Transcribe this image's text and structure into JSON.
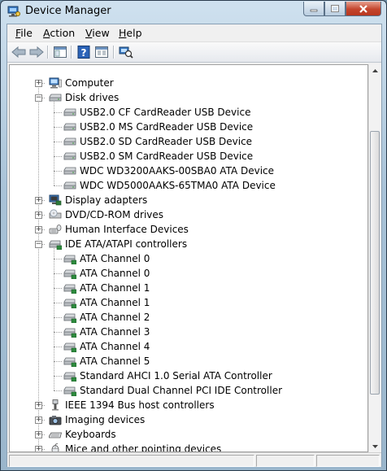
{
  "window": {
    "title": "Device Manager"
  },
  "menus": [
    {
      "key": "F",
      "rest": "ile"
    },
    {
      "key": "A",
      "rest": "ction"
    },
    {
      "key": "V",
      "rest": "iew"
    },
    {
      "key": "H",
      "rest": "elp"
    }
  ],
  "tree": [
    {
      "label": "Computer",
      "icon": "computer-icon",
      "level": 0,
      "state": "collapsed"
    },
    {
      "label": "Disk drives",
      "icon": "disk-drive-icon",
      "level": 0,
      "state": "expanded"
    },
    {
      "label": "USB2.0 CF  CardReader USB Device",
      "icon": "disk-drive-icon",
      "level": 1
    },
    {
      "label": "USB2.0 MS  CardReader USB Device",
      "icon": "disk-drive-icon",
      "level": 1
    },
    {
      "label": "USB2.0 SD  CardReader USB Device",
      "icon": "disk-drive-icon",
      "level": 1
    },
    {
      "label": "USB2.0 SM  CardReader USB Device",
      "icon": "disk-drive-icon",
      "level": 1
    },
    {
      "label": "WDC WD3200AAKS-00SBA0 ATA Device",
      "icon": "disk-drive-icon",
      "level": 1
    },
    {
      "label": "WDC WD5000AAKS-65TMA0 ATA Device",
      "icon": "disk-drive-icon",
      "level": 1
    },
    {
      "label": "Display adapters",
      "icon": "display-adapter-icon",
      "level": 0,
      "state": "collapsed"
    },
    {
      "label": "DVD/CD-ROM drives",
      "icon": "dvd-drive-icon",
      "level": 0,
      "state": "collapsed"
    },
    {
      "label": "Human Interface Devices",
      "icon": "hid-icon",
      "level": 0,
      "state": "collapsed"
    },
    {
      "label": "IDE ATA/ATAPI controllers",
      "icon": "ide-controller-icon",
      "level": 0,
      "state": "expanded"
    },
    {
      "label": "ATA Channel 0",
      "icon": "ide-controller-icon",
      "level": 1
    },
    {
      "label": "ATA Channel 0",
      "icon": "ide-controller-icon",
      "level": 1
    },
    {
      "label": "ATA Channel 1",
      "icon": "ide-controller-icon",
      "level": 1
    },
    {
      "label": "ATA Channel 1",
      "icon": "ide-controller-icon",
      "level": 1
    },
    {
      "label": "ATA Channel 2",
      "icon": "ide-controller-icon",
      "level": 1
    },
    {
      "label": "ATA Channel 3",
      "icon": "ide-controller-icon",
      "level": 1
    },
    {
      "label": "ATA Channel 4",
      "icon": "ide-controller-icon",
      "level": 1
    },
    {
      "label": "ATA Channel 5",
      "icon": "ide-controller-icon",
      "level": 1
    },
    {
      "label": "Standard AHCI 1.0 Serial ATA Controller",
      "icon": "ide-controller-icon",
      "level": 1
    },
    {
      "label": "Standard Dual Channel PCI IDE Controller",
      "icon": "ide-controller-icon",
      "level": 1
    },
    {
      "label": "IEEE 1394 Bus host controllers",
      "icon": "ieee1394-icon",
      "level": 0,
      "state": "collapsed"
    },
    {
      "label": "Imaging devices",
      "icon": "camera-icon",
      "level": 0,
      "state": "collapsed"
    },
    {
      "label": "Keyboards",
      "icon": "keyboard-icon",
      "level": 0,
      "state": "collapsed"
    },
    {
      "label": "Mice and other pointing devices",
      "icon": "mouse-icon",
      "level": 0,
      "state": "collapsed"
    }
  ],
  "colors": {
    "accent": "#3a6ea5",
    "close": "#c4452d"
  }
}
